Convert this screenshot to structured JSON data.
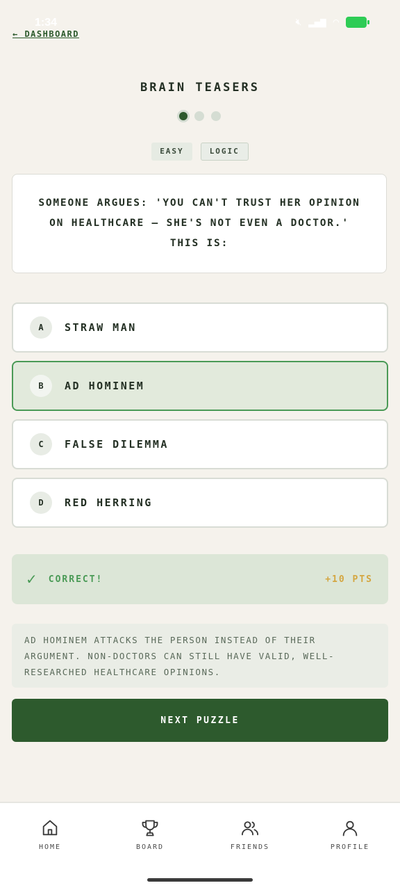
{
  "status_bar": {
    "time": "1:34"
  },
  "nav": {
    "back_label": "← DASHBOARD"
  },
  "title": "BRAIN TEASERS",
  "progress": {
    "total": 3,
    "current": 1
  },
  "tags": {
    "difficulty": "EASY",
    "category": "LOGIC"
  },
  "question": "SOMEONE ARGUES: 'YOU CAN'T TRUST HER OPINION ON HEALTHCARE — SHE'S NOT EVEN A DOCTOR.' THIS IS:",
  "options": [
    {
      "letter": "A",
      "label": "STRAW MAN",
      "selected": false
    },
    {
      "letter": "B",
      "label": "AD HOMINEM",
      "selected": true
    },
    {
      "letter": "C",
      "label": "FALSE DILEMMA",
      "selected": false
    },
    {
      "letter": "D",
      "label": "RED HERRING",
      "selected": false
    }
  ],
  "result": {
    "icon": "check-icon",
    "label": "CORRECT!",
    "points": "+10 PTS"
  },
  "explanation": "AD HOMINEM ATTACKS THE PERSON INSTEAD OF THEIR ARGUMENT. NON-DOCTORS CAN STILL HAVE VALID, WELL-RESEARCHED HEALTHCARE OPINIONS.",
  "next_button": "NEXT PUZZLE",
  "tab_bar": {
    "items": [
      {
        "label": "HOME",
        "icon": "home-icon"
      },
      {
        "label": "BOARD",
        "icon": "trophy-icon"
      },
      {
        "label": "FRIENDS",
        "icon": "friends-icon"
      },
      {
        "label": "PROFILE",
        "icon": "profile-icon"
      }
    ]
  },
  "colors": {
    "accent": "#2d5a2d",
    "correct": "#4a9a56",
    "points": "#d4a640",
    "background": "#f5f2ec"
  }
}
